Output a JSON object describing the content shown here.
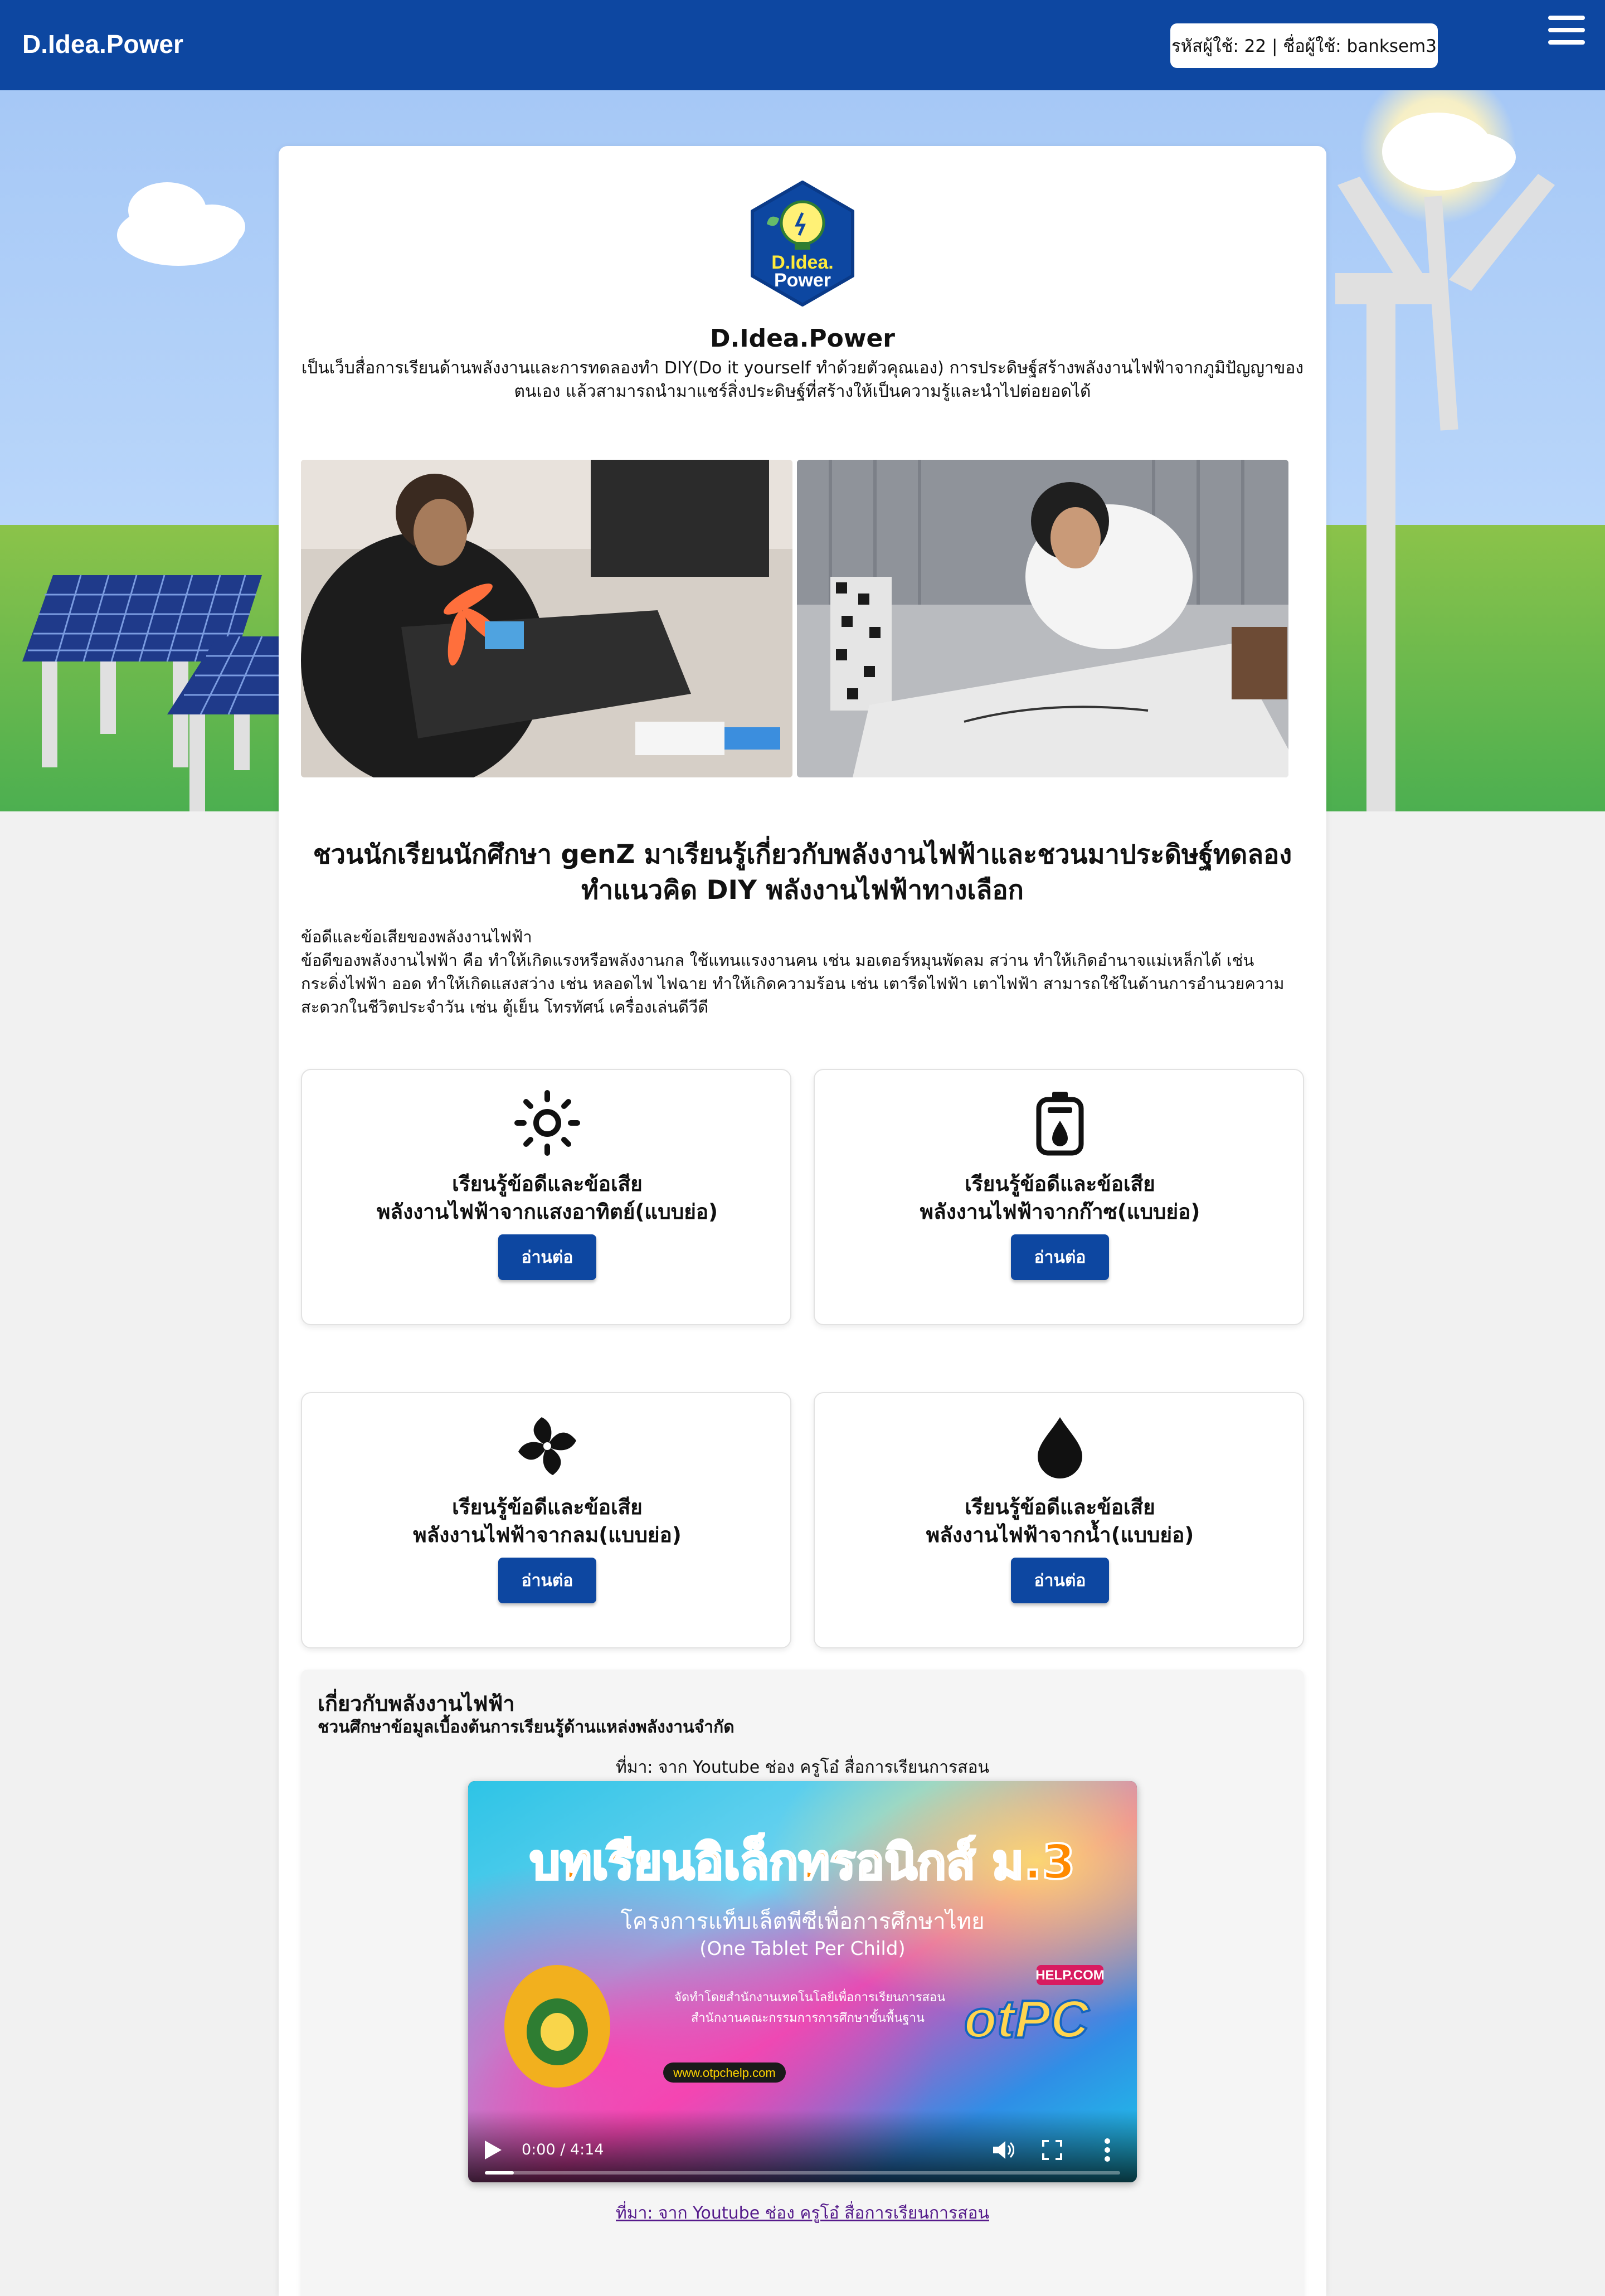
{
  "navbar": {
    "brand": "D.Idea.Power",
    "user_info": "รหัสผู้ใช้: 22 | ชื่อผู้ใช้: banksem3",
    "menu_icon": "hamburger-icon"
  },
  "hero": {
    "logo_line1": "D.Idea.",
    "logo_line2": "Power",
    "title": "D.Idea.Power",
    "description": "เป็นเว็บสื่อการเรียนด้านพลังงานและการทดลองทำ DIY(Do it yourself ทำด้วยตัวคุณเอง) การประดิษฐ์สร้างพลังงานไฟฟ้าจากภูมิปัญญาของตนเอง แล้วสามารถนำมาแชร์สิ่งประดิษฐ์ที่สร้างให้เป็นความรู้และนำไปต่อยอดได้"
  },
  "headline": "ชวนนักเรียนนักศึกษา genZ มาเรียนรู้เกี่ยวกับพลังงานไฟฟ้าและชวนมาประดิษฐ์ทดลองทำแนวคิด DIY พลังงานไฟฟ้าทางเลือก",
  "intro": {
    "heading": "ข้อดีและข้อเสียของพลังงานไฟฟ้า",
    "body": "ข้อดีของพลังงานไฟฟ้า คือ ทำให้เกิดแรงหรือพลังงานกล ใช้แทนแรงงานคน เช่น มอเตอร์หมุนพัดลม สว่าน ทำให้เกิดอำนาจแม่เหล็กได้ เช่น กระดิ่งไฟฟ้า ออด ทำให้เกิดแสงสว่าง เช่น หลอดไฟ ไฟฉาย ทำให้เกิดความร้อน เช่น เตารีดไฟฟ้า เตาไฟฟ้า สามารถใช้ในด้านการอำนวยความสะดวกในชีวิตประจำวัน เช่น ตู้เย็น โทรทัศน์ เครื่องเล่นดีวีดี"
  },
  "features": [
    {
      "icon": "sun-icon",
      "line1": "เรียนรู้ข้อดีและข้อเสีย",
      "line2": "พลังงานไฟฟ้าจากแสงอาทิตย์(แบบย่อ)",
      "button": "อ่านต่อ"
    },
    {
      "icon": "gas-cylinder-icon",
      "line1": "เรียนรู้ข้อดีและข้อเสีย",
      "line2": "พลังงานไฟฟ้าจากก๊าซ(แบบย่อ)",
      "button": "อ่านต่อ"
    },
    {
      "icon": "wind-fan-icon",
      "line1": "เรียนรู้ข้อดีและข้อเสีย",
      "line2": "พลังงานไฟฟ้าจากลม(แบบย่อ)",
      "button": "อ่านต่อ"
    },
    {
      "icon": "water-drop-icon",
      "line1": "เรียนรู้ข้อดีและข้อเสีย",
      "line2": "พลังงานไฟฟ้าจากน้ำ(แบบย่อ)",
      "button": "อ่านต่อ"
    }
  ],
  "about": {
    "title": "เกี่ยวกับพลังงานไฟฟ้า",
    "subtitle": "ชวนศึกษาข้อมูลเบื้องต้นการเรียนรู้ด้านแหล่งพลังงานจำกัด",
    "source_caption": "ที่มา: จาก Youtube ช่อง ครูโอ๋ สื่อการเรียนการสอน",
    "source_link": "ที่มา: จาก Youtube ช่อง ครูโอ๋ สื่อการเรียนการสอน"
  },
  "video": {
    "title_text": "บทเรียนอิเล็กทรอนิกส์ ม.3",
    "subtitle1": "โครงการแท็บเล็ตพีซีเพื่อการศึกษาไทย",
    "subtitle2": "(One Tablet Per Child)",
    "credit1": "จัดทำโดยสำนักงานเทคโนโลยีเพื่อการเรียนการสอน",
    "credit2": "สำนักงานคณะกรรมการการศึกษาขั้นพื้นฐาน",
    "url_badge": "www.otpchelp.com",
    "otpc_logo": "otPC",
    "otpc_help": "HELP.COM",
    "time": "0:00 / 4:14",
    "progress": 0.046
  },
  "colors": {
    "nav": "#0d47a1",
    "button": "#0d47a1",
    "sky": "#aac9f5",
    "grass": "#6cbf43"
  }
}
